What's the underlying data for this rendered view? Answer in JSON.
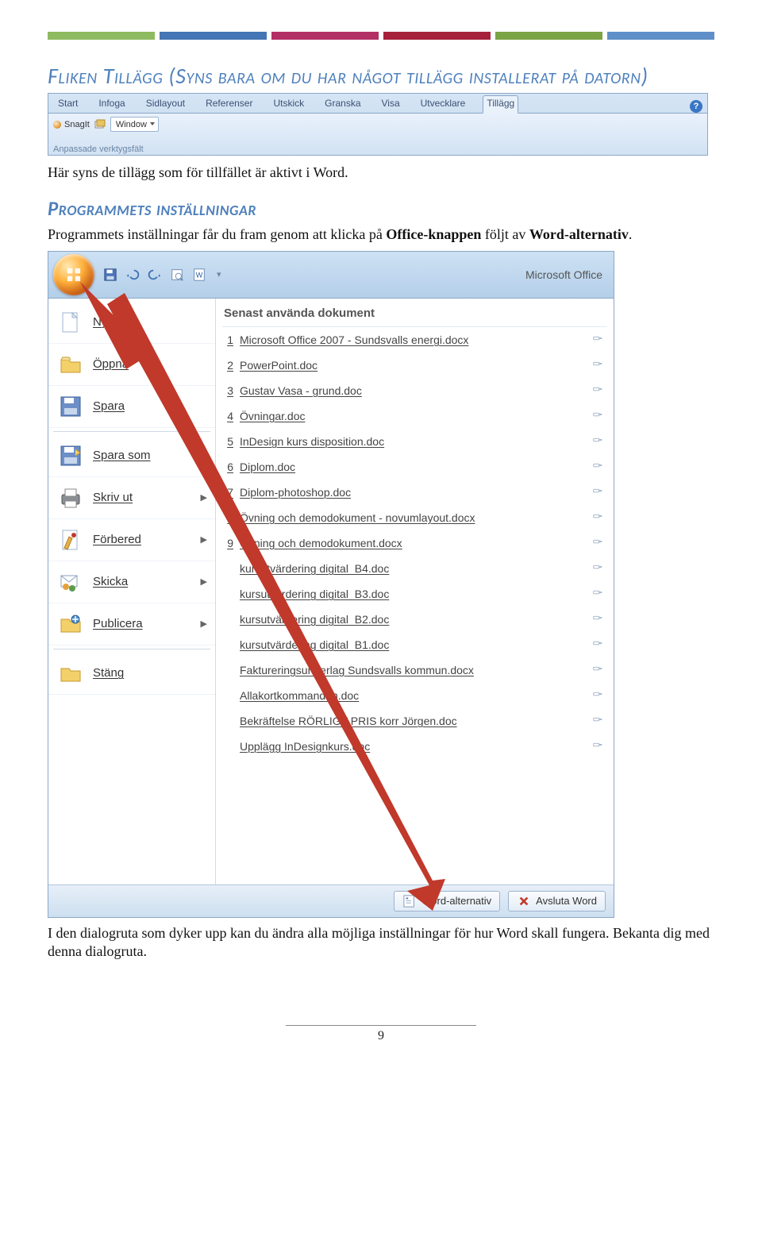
{
  "accent_bars": [
    "#8fbb60",
    "#4475b4",
    "#b23065",
    "#a6203c",
    "#7ba444",
    "#5f8fc9"
  ],
  "headings": {
    "fliken": "Fliken Tillägg (Syns bara om du har något tillägg installerat på datorn)",
    "installningar": "Programmets inställningar"
  },
  "body": {
    "p1": "Här syns de tillägg som för tillfället är aktivt i Word.",
    "p2_pre": "Programmets inställningar får du fram genom att klicka på ",
    "p2_bold1": "Office-knappen",
    "p2_mid": " följt av ",
    "p2_bold2": "Word-alternativ",
    "p2_post": ".",
    "p3": "I den dialogruta som dyker upp kan du ändra alla möjliga inställningar för hur Word skall fungera. Bekanta dig med denna dialogruta."
  },
  "ribbon": {
    "tabs": [
      "Start",
      "Infoga",
      "Sidlayout",
      "Referenser",
      "Utskick",
      "Granska",
      "Visa",
      "Utvecklare",
      "Tillägg"
    ],
    "active": 8,
    "snagit_label": "SnagIt",
    "snagit_combo": "Window",
    "group": "Anpassade verktygsfält"
  },
  "menu": {
    "mslabel": "Microsoft Office",
    "left": [
      {
        "label": "Nytt",
        "sub": false
      },
      {
        "label": "Öppna",
        "sub": false
      },
      {
        "label": "Spara",
        "sub": false
      },
      {
        "label": "Spara som",
        "sub": true
      },
      {
        "label": "Skriv ut",
        "sub": true
      },
      {
        "label": "Förbered",
        "sub": true
      },
      {
        "label": "Skicka",
        "sub": true
      },
      {
        "label": "Publicera",
        "sub": true
      },
      {
        "label": "Stäng",
        "sub": false
      }
    ],
    "recent_head": "Senast använda dokument",
    "recent": [
      {
        "n": "1",
        "name": "Microsoft Office 2007 - Sundsvalls energi.docx"
      },
      {
        "n": "2",
        "name": "PowerPoint.doc"
      },
      {
        "n": "3",
        "name": "Gustav Vasa - grund.doc"
      },
      {
        "n": "4",
        "name": "Övningar.doc"
      },
      {
        "n": "5",
        "name": "InDesign kurs disposition.doc"
      },
      {
        "n": "6",
        "name": "Diplom.doc"
      },
      {
        "n": "7",
        "name": "Diplom-photoshop.doc"
      },
      {
        "n": "8",
        "name": "Övning och demodokument - novumlayout.docx"
      },
      {
        "n": "9",
        "name": "Övning och demodokument.docx"
      },
      {
        "n": "",
        "name": "kursutvärdering digital_B4.doc"
      },
      {
        "n": "",
        "name": "kursutvärdering digital_B3.doc"
      },
      {
        "n": "",
        "name": "kursutvärdering digital_B2.doc"
      },
      {
        "n": "",
        "name": "kursutvärdering digital_B1.doc"
      },
      {
        "n": "",
        "name": "Faktureringsunderlag Sundsvalls kommun.docx"
      },
      {
        "n": "",
        "name": "Allakortkommandon.doc"
      },
      {
        "n": "",
        "name": "Bekräftelse RÖRLIGT PRIS korr Jörgen.doc"
      },
      {
        "n": "",
        "name": "Upplägg InDesignkurs.doc"
      }
    ],
    "bottom": {
      "options": "Word-alternativ",
      "exit": "Avsluta Word"
    }
  },
  "page_no": "9"
}
